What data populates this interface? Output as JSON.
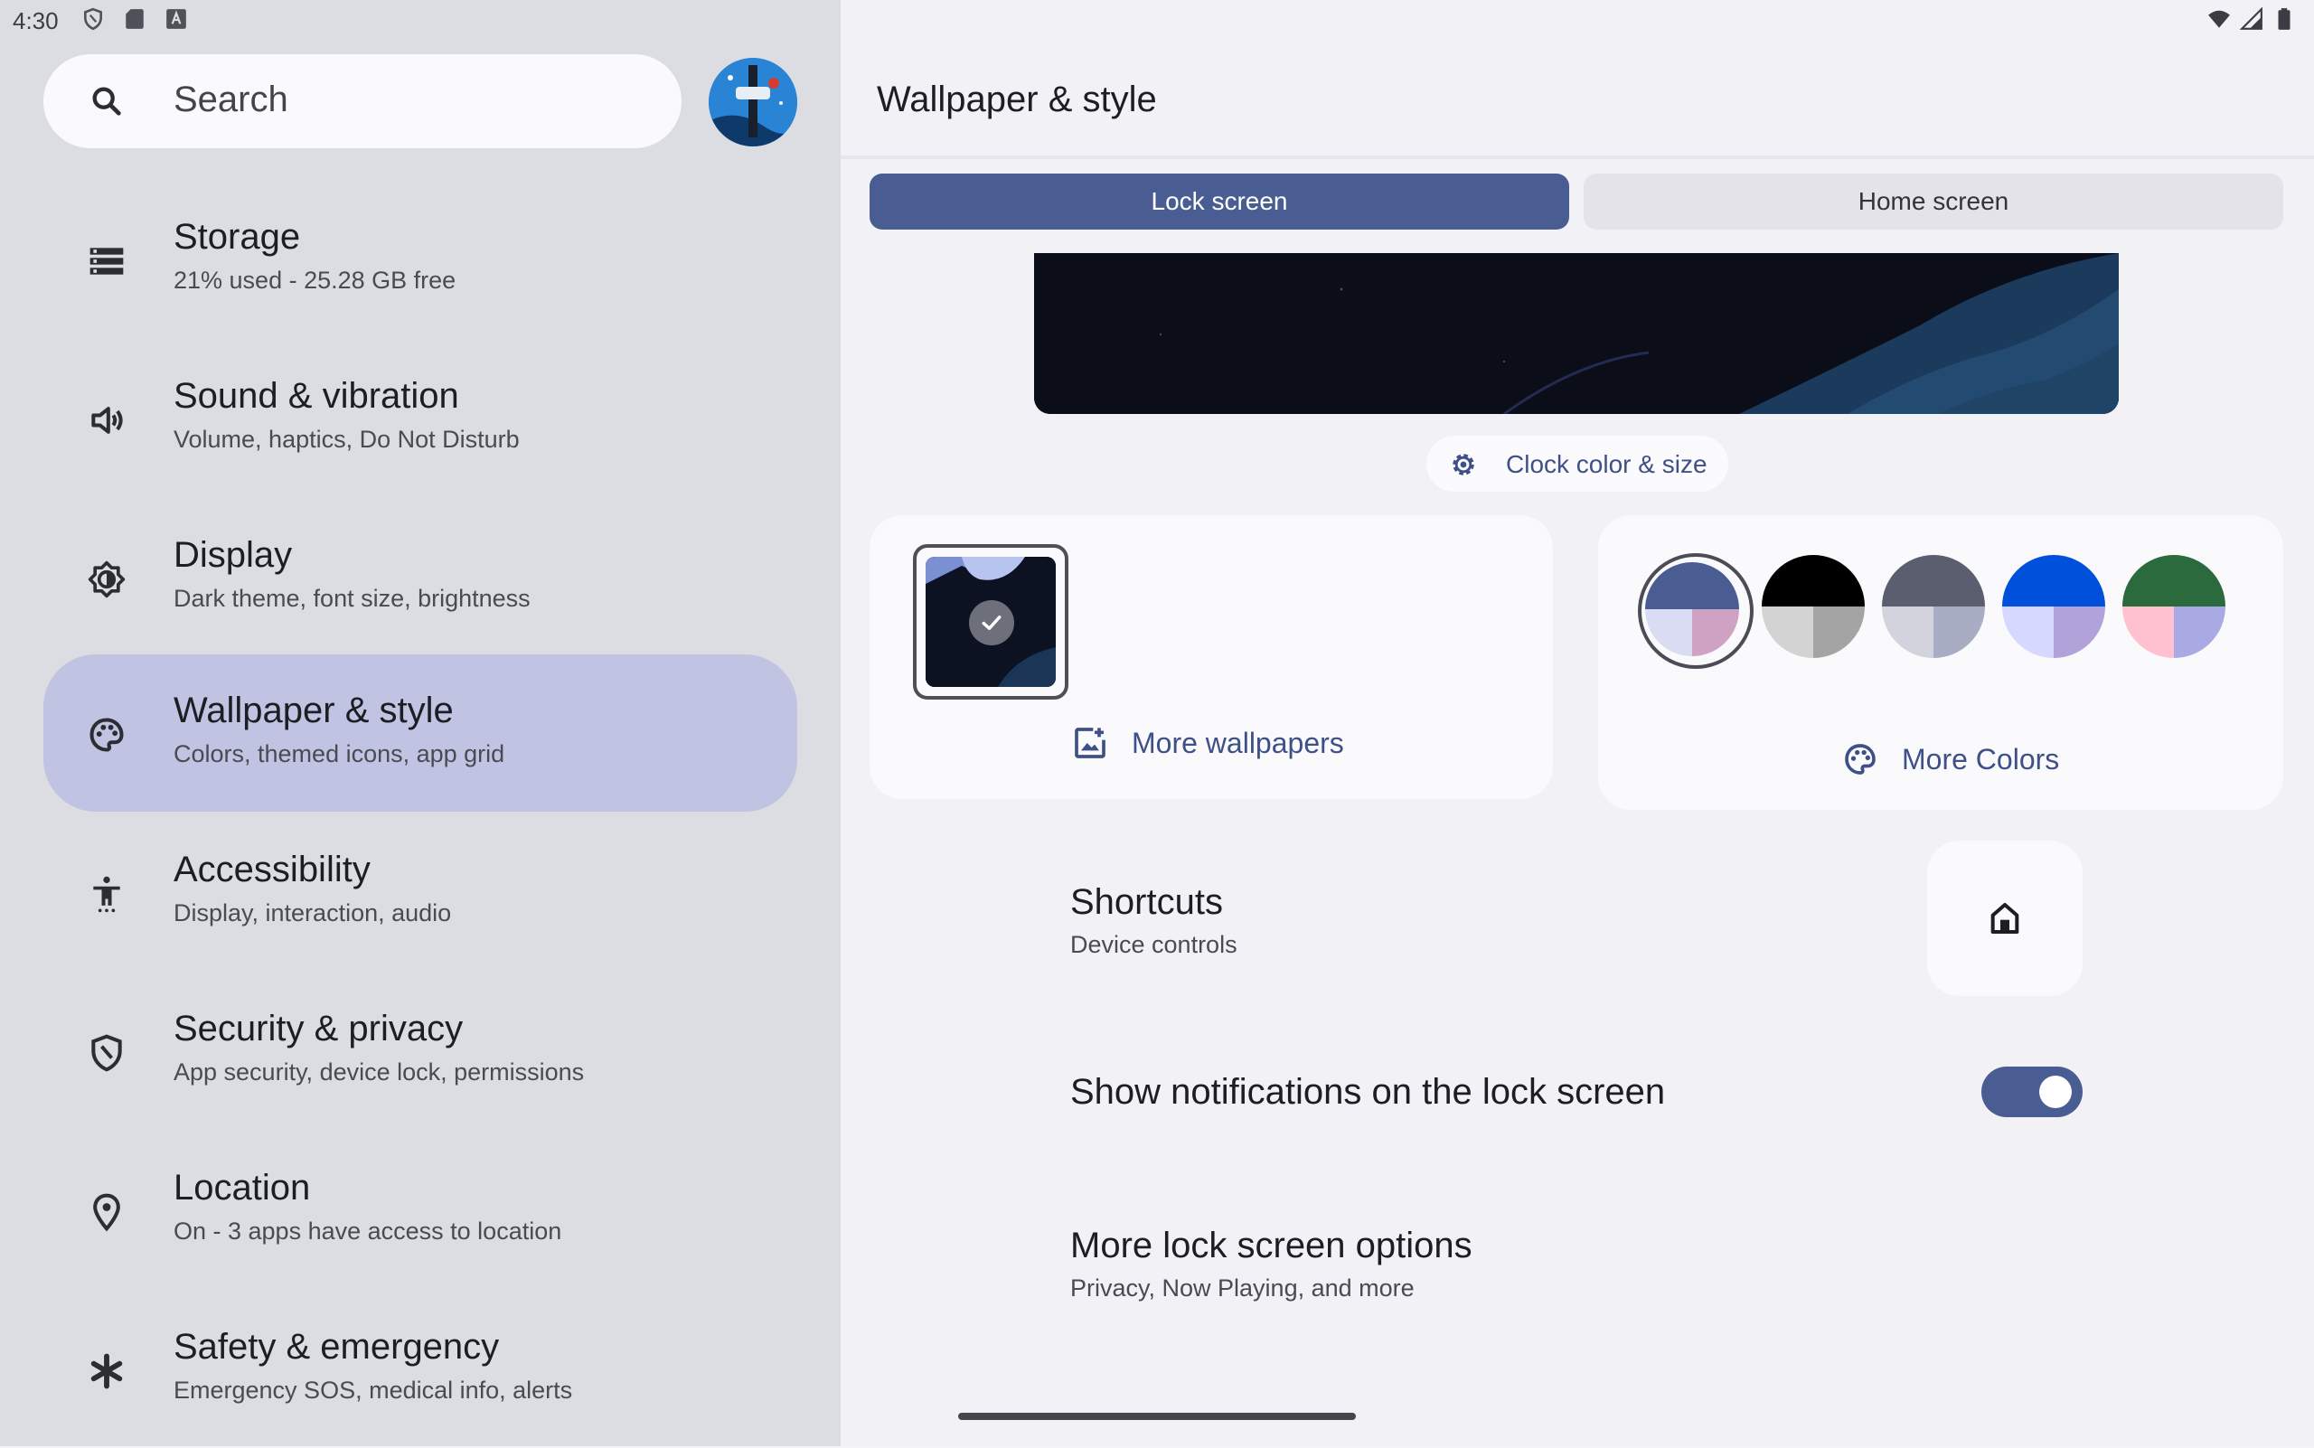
{
  "status_bar": {
    "time": "4:30",
    "left_icons": [
      "shield-icon",
      "sd-card-icon",
      "keyboard-a-icon"
    ],
    "right_icons": [
      "wifi-icon",
      "signal-icon",
      "battery-icon"
    ]
  },
  "sidebar": {
    "search_placeholder": "Search",
    "items": [
      {
        "icon": "storage-icon",
        "title": "Storage",
        "subtitle": "21% used - 25.28 GB free"
      },
      {
        "icon": "volume-icon",
        "title": "Sound & vibration",
        "subtitle": "Volume, haptics, Do Not Disturb"
      },
      {
        "icon": "brightness-icon",
        "title": "Display",
        "subtitle": "Dark theme, font size, brightness"
      },
      {
        "icon": "palette-icon",
        "title": "Wallpaper & style",
        "subtitle": "Colors, themed icons, app grid",
        "selected": true
      },
      {
        "icon": "accessibility-icon",
        "title": "Accessibility",
        "subtitle": "Display, interaction, audio"
      },
      {
        "icon": "shield-icon",
        "title": "Security & privacy",
        "subtitle": "App security, device lock, permissions"
      },
      {
        "icon": "location-pin-icon",
        "title": "Location",
        "subtitle": "On - 3 apps have access to location"
      },
      {
        "icon": "asterisk-icon",
        "title": "Safety & emergency",
        "subtitle": "Emergency SOS, medical info, alerts"
      }
    ]
  },
  "main": {
    "title": "Wallpaper & style",
    "tabs": [
      {
        "label": "Lock screen",
        "selected": true
      },
      {
        "label": "Home screen",
        "selected": false
      }
    ],
    "clock_chip_label": "Clock color & size",
    "more_wallpapers_label": "More wallpapers",
    "more_colors_label": "More Colors",
    "color_swatches": [
      {
        "top": "#4a5d93",
        "bottom_left": "#d9dcf2",
        "bottom_right": "#cfa2c4",
        "selected": true
      },
      {
        "top": "#000000",
        "bottom_left": "#d3d3d3",
        "bottom_right": "#a4a4a4",
        "selected": false
      },
      {
        "top": "#5b5e6e",
        "bottom_left": "#d3d3de",
        "bottom_right": "#a9adc4",
        "selected": false
      },
      {
        "top": "#0050dc",
        "bottom_left": "#d6d8ff",
        "bottom_right": "#b2a2da",
        "selected": false
      },
      {
        "top": "#2a6a3c",
        "bottom_left": "#ffc1cf",
        "bottom_right": "#a9aae3",
        "selected": false
      }
    ],
    "shortcuts": {
      "title": "Shortcuts",
      "subtitle": "Device controls",
      "icon": "home-icon"
    },
    "notifications": {
      "title": "Show notifications on the lock screen",
      "enabled": true
    },
    "more_options": {
      "title": "More lock screen options",
      "subtitle": "Privacy, Now Playing, and more"
    }
  },
  "colors": {
    "accent": "#495d92",
    "sidebar_selected": "#c0c4e2",
    "sidebar_bg": "#dcdce3",
    "main_bg": "#f1f1f6"
  }
}
